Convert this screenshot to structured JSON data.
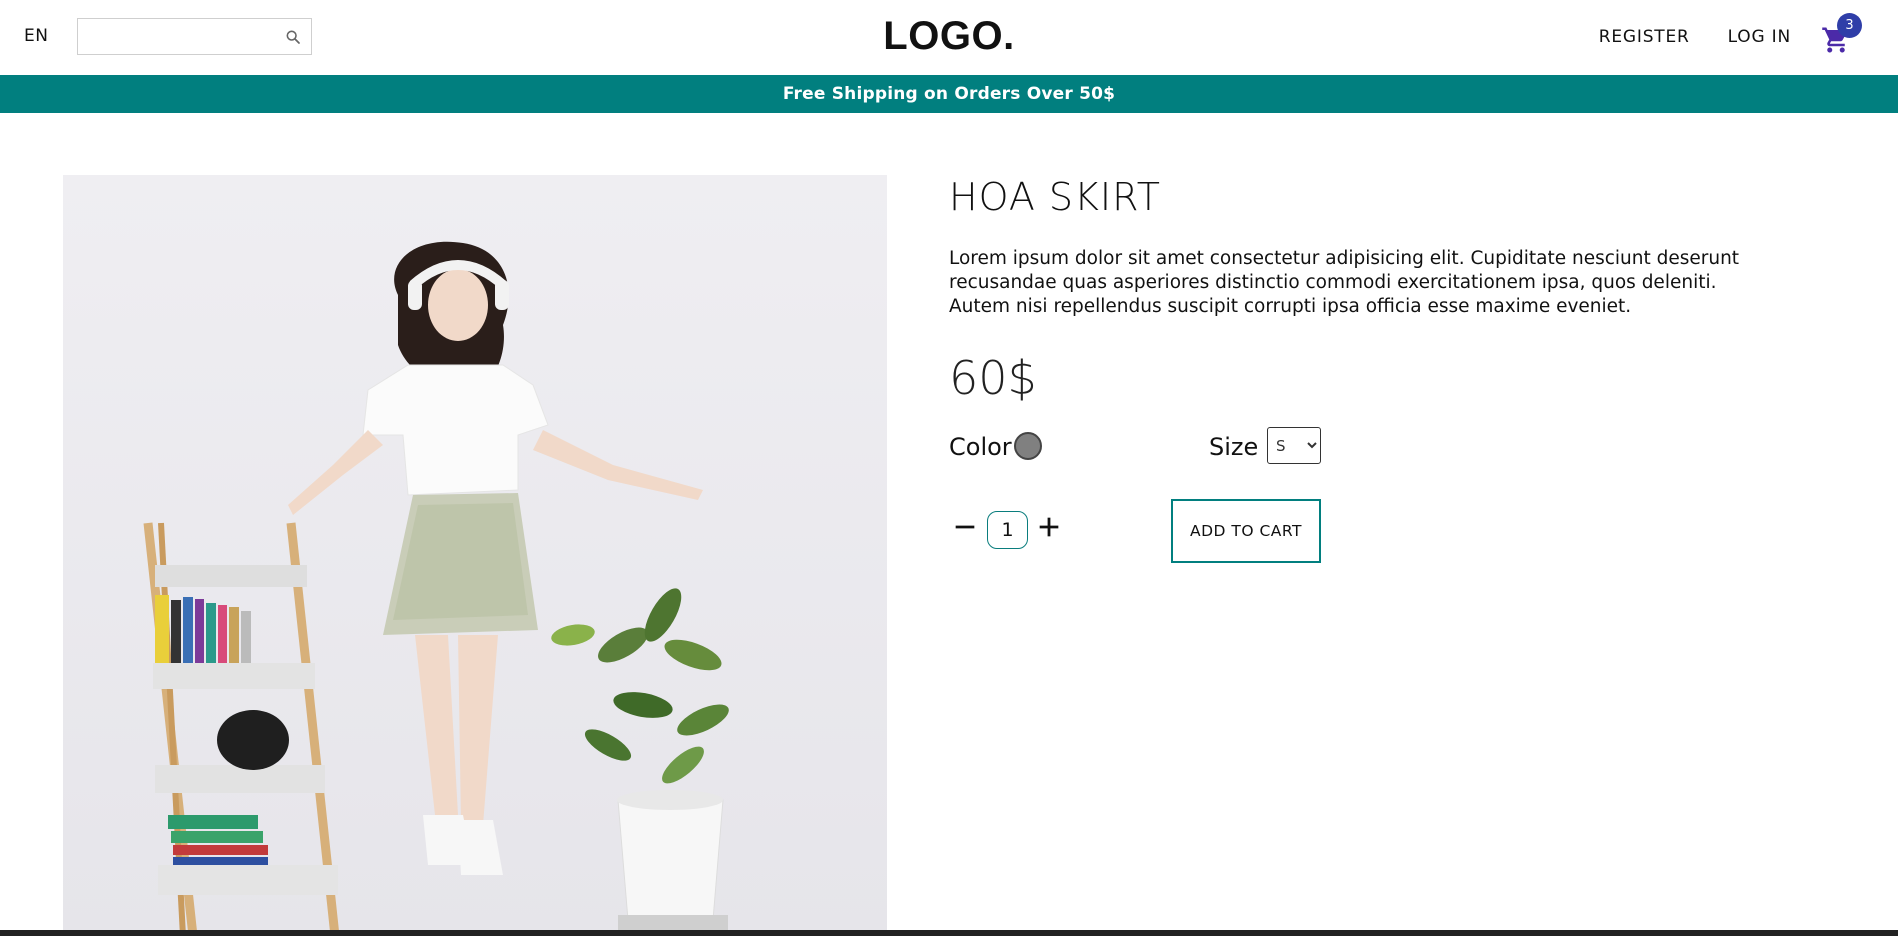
{
  "header": {
    "language": "EN",
    "search": {
      "value": "",
      "placeholder": ""
    },
    "logo": "LOGO.",
    "register": "REGISTER",
    "login": "LOG IN",
    "cart_count": "3"
  },
  "announcement": "Free Shipping on Orders Over 50$",
  "product": {
    "title": "HOA SKIRT",
    "description": "Lorem ipsum dolor sit amet consectetur adipisicing elit. Cupiditate nesciunt deserunt recusandae quas asperiores distinctio commodi exercitationem ipsa, quos deleniti. Autem nisi repellendus suscipit corrupti ipsa officia esse maxime eveniet.",
    "price": "60$",
    "color_label": "Color",
    "color_value": "#808080",
    "size_label": "Size",
    "size_selected": "S",
    "quantity": "1",
    "add_to_cart": "ADD TO CART"
  },
  "colors": {
    "accent": "#017f7f",
    "badge": "#2f3ea8",
    "cart_icon": "#4b2aa8"
  },
  "icons": [
    "search-icon",
    "cart-icon",
    "minus-icon",
    "plus-icon"
  ]
}
